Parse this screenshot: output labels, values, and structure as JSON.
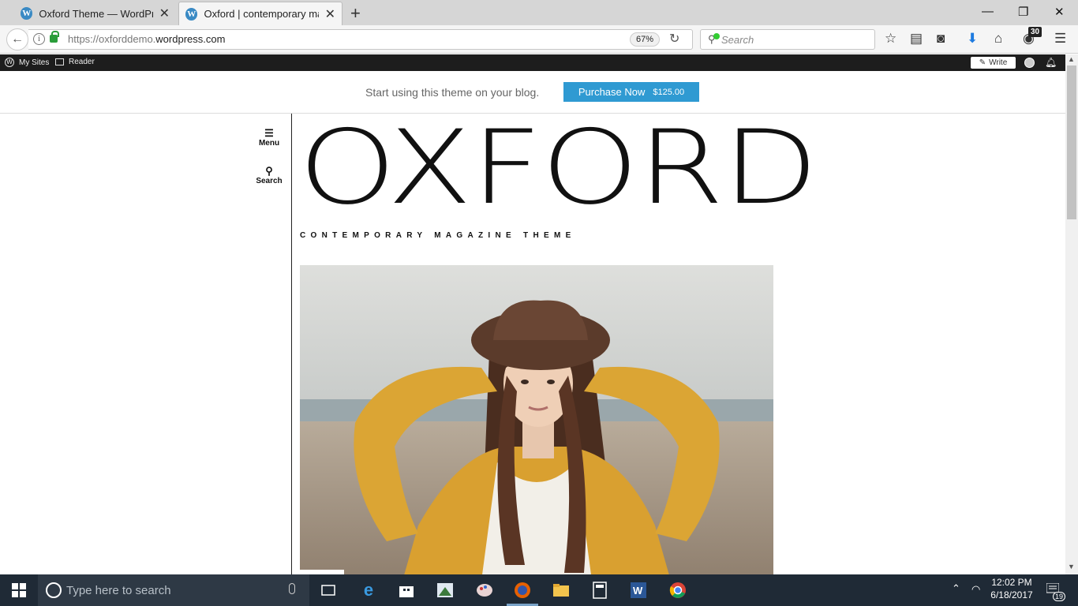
{
  "browser": {
    "tabs": [
      {
        "title": "Oxford Theme — WordPress.com",
        "active": false
      },
      {
        "title": "Oxford | contemporary magazine theme",
        "active": true
      }
    ],
    "url_prefix": "https://oxforddemo.",
    "url_domain": "wordpress.com",
    "zoom": "67%",
    "search_placeholder": "Search",
    "badge_count": "30",
    "window": {
      "minimize": "—",
      "restore": "❐",
      "close": "✕"
    }
  },
  "admin_bar": {
    "my_sites": "My Sites",
    "reader": "Reader",
    "write": "Write"
  },
  "promo": {
    "text": "Start using this theme on your blog.",
    "button_label": "Purchase Now",
    "price": "$125.00"
  },
  "side_nav": {
    "menu_label": "Menu",
    "search_label": "Search"
  },
  "site": {
    "title": "OXFORD",
    "tagline": "CONTEMPORARY MAGAZINE THEME"
  },
  "taskbar": {
    "search_placeholder": "Type here to search",
    "time": "12:02 PM",
    "date": "6/18/2017",
    "notifications": "19"
  },
  "colors": {
    "accent": "#2f9ad2",
    "admin_bar": "#1d1d1d",
    "taskbar": "#1f2a36"
  }
}
